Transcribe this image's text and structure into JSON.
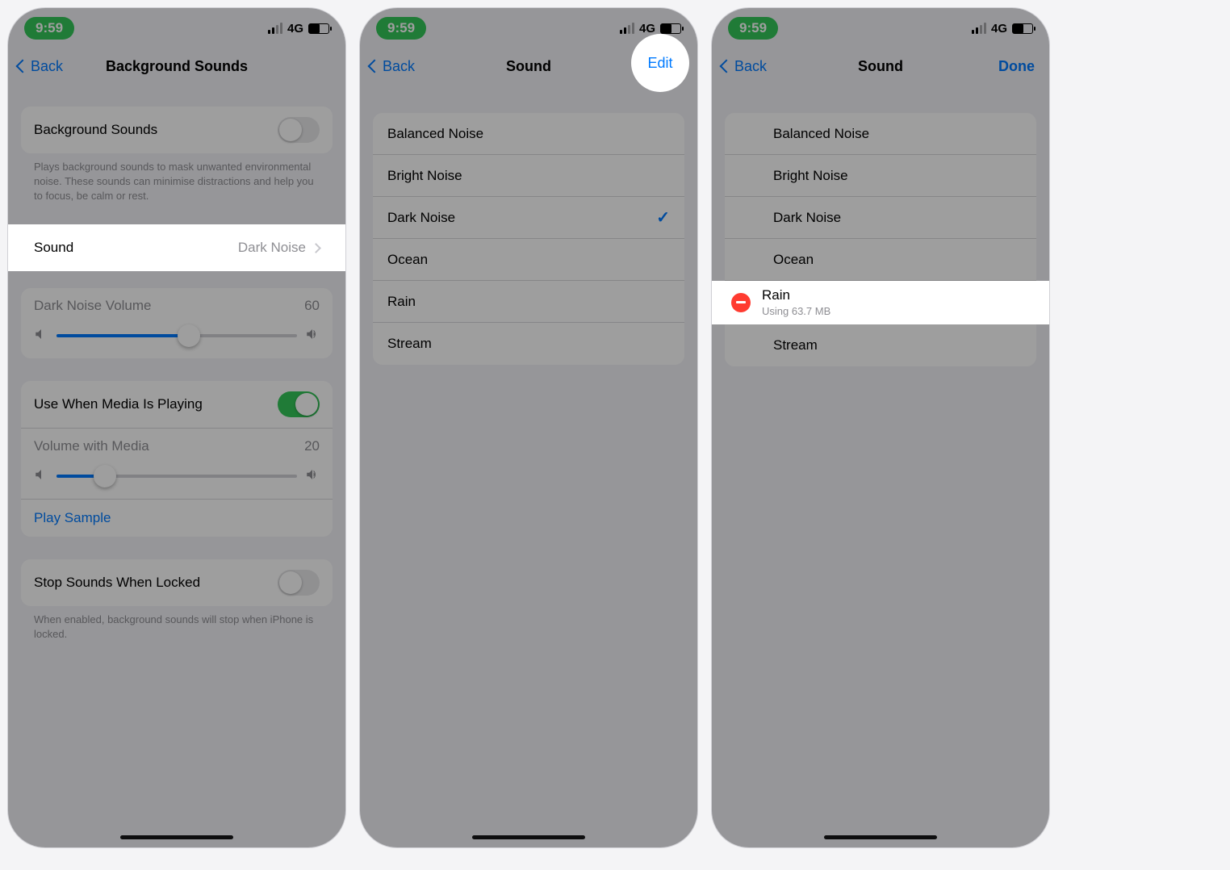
{
  "status": {
    "time": "9:59",
    "carrier": "4G"
  },
  "screen1": {
    "back": "Back",
    "title": "Background Sounds",
    "bg_toggle_label": "Background Sounds",
    "bg_toggle_desc": "Plays background sounds to mask unwanted environmental noise. These sounds can minimise distractions and help you to focus, be calm or rest.",
    "sound_label": "Sound",
    "sound_value": "Dark Noise",
    "vol_label": "Dark Noise Volume",
    "vol_value": "60",
    "vol_percent": 55,
    "media_toggle_label": "Use When Media Is Playing",
    "media_vol_label": "Volume with Media",
    "media_vol_value": "20",
    "media_vol_percent": 20,
    "play_sample": "Play Sample",
    "stop_label": "Stop Sounds When Locked",
    "stop_desc": "When enabled, background sounds will stop when iPhone is locked."
  },
  "screen2": {
    "back": "Back",
    "title": "Sound",
    "edit": "Edit",
    "items": [
      "Balanced Noise",
      "Bright Noise",
      "Dark Noise",
      "Ocean",
      "Rain",
      "Stream"
    ],
    "selected_index": 2
  },
  "screen3": {
    "back": "Back",
    "title": "Sound",
    "done": "Done",
    "items": [
      {
        "label": "Balanced Noise"
      },
      {
        "label": "Bright Noise"
      },
      {
        "label": "Dark Noise"
      },
      {
        "label": "Ocean"
      },
      {
        "label": "Rain",
        "sub": "Using 63.7 MB",
        "deletable": true
      },
      {
        "label": "Stream"
      }
    ]
  }
}
